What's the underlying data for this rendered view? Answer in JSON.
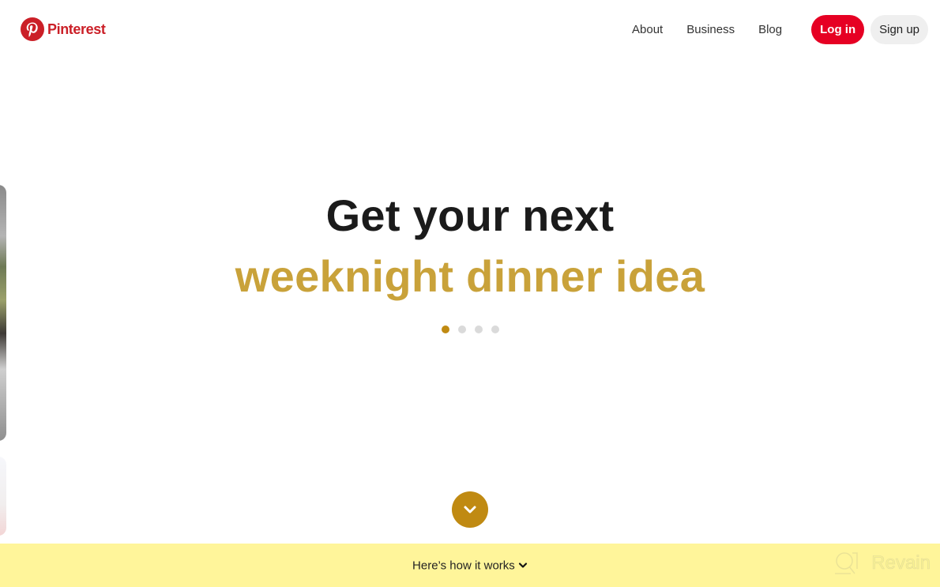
{
  "header": {
    "brand": "Pinterest",
    "nav": [
      {
        "label": "About"
      },
      {
        "label": "Business"
      },
      {
        "label": "Blog"
      }
    ],
    "login_label": "Log in",
    "signup_label": "Sign up"
  },
  "hero": {
    "line1": "Get your next",
    "line2": "weeknight dinner idea",
    "carousel": {
      "total": 4,
      "active_index": 0
    }
  },
  "footer": {
    "how_it_works_label": "Here’s how it works",
    "watermark": "Revain"
  },
  "colors": {
    "brand_red": "#e60023",
    "accent_gold": "#c9a23a",
    "dot_active": "#c08a12",
    "footer_yellow": "#fff59a"
  },
  "icons": {
    "logo": "pinterest-p-icon",
    "scroll": "chevron-down-icon",
    "how_it_works": "chevron-down-icon"
  }
}
